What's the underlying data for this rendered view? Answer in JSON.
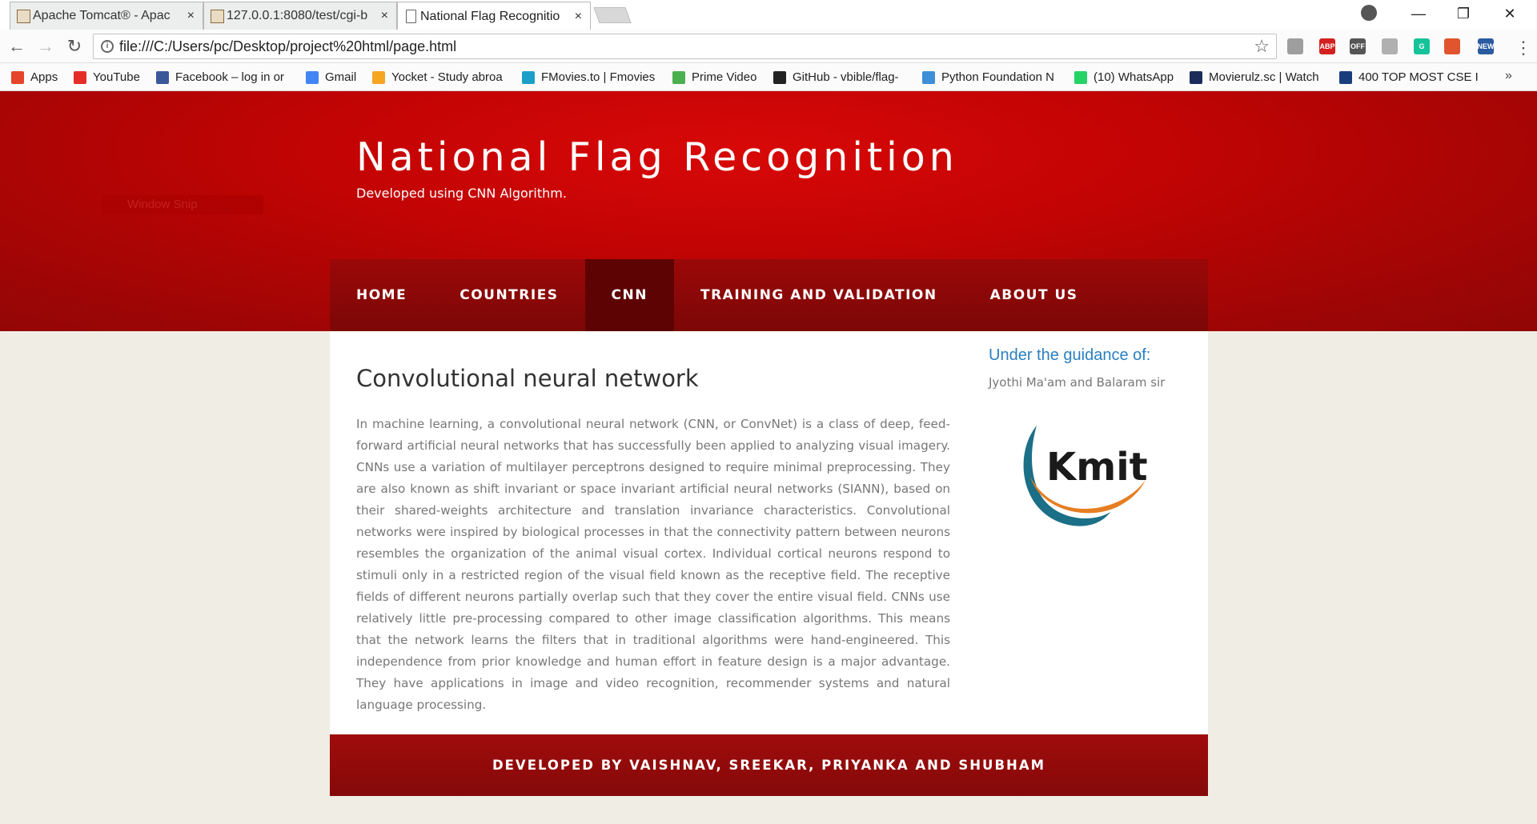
{
  "browser": {
    "tabs": [
      {
        "title": "Apache Tomcat® - Apac",
        "close": "×"
      },
      {
        "title": "127.0.0.1:8080/test/cgi-b",
        "close": "×"
      },
      {
        "title": "National Flag Recognitio",
        "close": "×"
      }
    ],
    "window_controls": {
      "minimize": "—",
      "restore": "❐",
      "close": "✕"
    },
    "nav": {
      "back": "←",
      "forward": "→",
      "reload": "↻"
    },
    "address": "file:///C:/Users/pc/Desktop/project%20html/page.html",
    "extensions": [
      {
        "name": "docs-icon",
        "text": "",
        "color": "#9e9e9e"
      },
      {
        "name": "adblock-plus-icon",
        "text": "ABP",
        "color": "#d32020"
      },
      {
        "name": "off-toggle-icon",
        "text": "OFF",
        "color": "#555555"
      },
      {
        "name": "extension-icon",
        "text": "",
        "color": "#b0b0b0"
      },
      {
        "name": "grammarly-icon",
        "text": "G",
        "color": "#15c39a"
      },
      {
        "name": "office-icon",
        "text": "",
        "color": "#e0552e"
      },
      {
        "name": "news-icon",
        "text": "NEW",
        "color": "#2a5aa0"
      }
    ],
    "bookmarks": [
      {
        "label": "Apps",
        "icon_color": "#e5452b"
      },
      {
        "label": "YouTube",
        "icon_color": "#e52d27"
      },
      {
        "label": "Facebook – log in or",
        "icon_color": "#3b5998"
      },
      {
        "label": "Gmail",
        "icon_color": "#4285f4"
      },
      {
        "label": "Yocket - Study abroa",
        "icon_color": "#f5a623"
      },
      {
        "label": "FMovies.to | Fmovies",
        "icon_color": "#1aa0c8"
      },
      {
        "label": "Prime Video",
        "icon_color": "#4caf50"
      },
      {
        "label": "GitHub - vbible/flag-",
        "icon_color": "#222222"
      },
      {
        "label": "Python Foundation N",
        "icon_color": "#3d8fd8"
      },
      {
        "label": "(10) WhatsApp",
        "icon_color": "#25d366"
      },
      {
        "label": "Movierulz.sc | Watch",
        "icon_color": "#1b2b5a"
      },
      {
        "label": "400 TOP MOST CSE I",
        "icon_color": "#1a3d7c"
      }
    ],
    "bookmarks_more": "»"
  },
  "site": {
    "title": "National Flag Recognition",
    "subtitle": "Developed using CNN Algorithm.",
    "snip_ghost": "Window Snip",
    "nav": [
      "HOME",
      "COUNTRIES",
      "CNN",
      "TRAINING AND VALIDATION",
      "ABOUT US"
    ],
    "active_nav": "CNN",
    "main": {
      "title": "Convolutional neural network",
      "body": "In machine learning, a convolutional neural network (CNN, or ConvNet) is a class of deep, feed-forward artificial neural networks that has successfully been applied to analyzing visual imagery. CNNs use a variation of multilayer perceptrons designed to require minimal preprocessing. They are also known as shift invariant or space invariant artificial neural networks (SIANN), based on their shared-weights architecture and translation invariance characteristics. Convolutional networks were inspired by biological processes in that the connectivity pattern between neurons resembles the organization of the animal visual cortex. Individual cortical neurons respond to stimuli only in a restricted region of the visual field known as the receptive field. The receptive fields of different neurons partially overlap such that they cover the entire visual field. CNNs use relatively little pre-processing compared to other image classification algorithms. This means that the network learns the filters that in traditional algorithms were hand-engineered. This independence from prior knowledge and human effort in feature design is a major advantage. They have applications in image and video recognition, recommender systems and natural language processing."
    },
    "sidebar": {
      "title": "Under the guidance of:",
      "text": "Jyothi Ma'am and Balaram sir",
      "logo_text": "Kmit"
    },
    "footer": "DEVELOPED BY VAISHNAV, SREEKAR, PRIYANKA AND SHUBHAM"
  },
  "colors": {
    "hero_red": "#c40404",
    "nav_red": "#8a0707",
    "nav_active": "#5e0303",
    "footer_red": "#950a0a",
    "sidebar_blue": "#2a7fc0",
    "page_bg": "#f0ede4"
  }
}
